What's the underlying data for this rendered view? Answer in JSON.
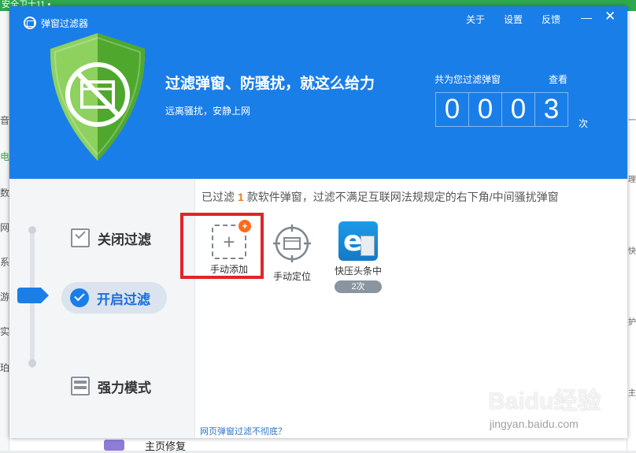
{
  "background": {
    "top_text": "安全卫士11 •",
    "left_fragments": [
      "音",
      "电",
      "数",
      "网",
      "系",
      "游",
      "实",
      "珀"
    ],
    "right_fragments": [
      "一",
      "理",
      "快",
      "护",
      "主页"
    ],
    "bottom_text": "主页修复"
  },
  "window": {
    "title": "弹窗过滤器",
    "menu": {
      "about": "关于",
      "settings": "设置",
      "feedback": "反馈"
    },
    "minimize": "—",
    "close": "✕"
  },
  "header": {
    "headline": "过滤弹窗、防骚扰，就这么给力",
    "subline": "远离骚扰，安静上网",
    "counter_label": "共为您过滤弹窗",
    "view_link": "查看",
    "counter_digits": [
      "0",
      "0",
      "0",
      "3"
    ],
    "counter_unit": "次",
    "shield_color": "#5db536"
  },
  "modes": {
    "off": "关闭过滤",
    "on": "开启过滤",
    "strong": "强力模式",
    "selected": "on"
  },
  "content": {
    "note_prefix": "已过滤",
    "note_count": "1",
    "note_suffix": "款软件弹窗，过滤不满足互联网法规规定的右下角/中间骚扰弹窗",
    "tiles": [
      {
        "label": "手动添加",
        "icon": "dashed-plus-icon",
        "badge": "+"
      },
      {
        "label": "手动定位",
        "icon": "crosshair-icon"
      },
      {
        "label": "快压头条中",
        "icon": "ie-app-icon",
        "count": "2次"
      }
    ],
    "web_link": "网页弹窗过滤不彻底？"
  },
  "watermark": {
    "brand": "Baidu经验",
    "url": "jingyan.baidu.com"
  },
  "colors": {
    "accent": "#1a7ee8",
    "highlight": "#e3232a",
    "badge": "#ff6b1a"
  }
}
